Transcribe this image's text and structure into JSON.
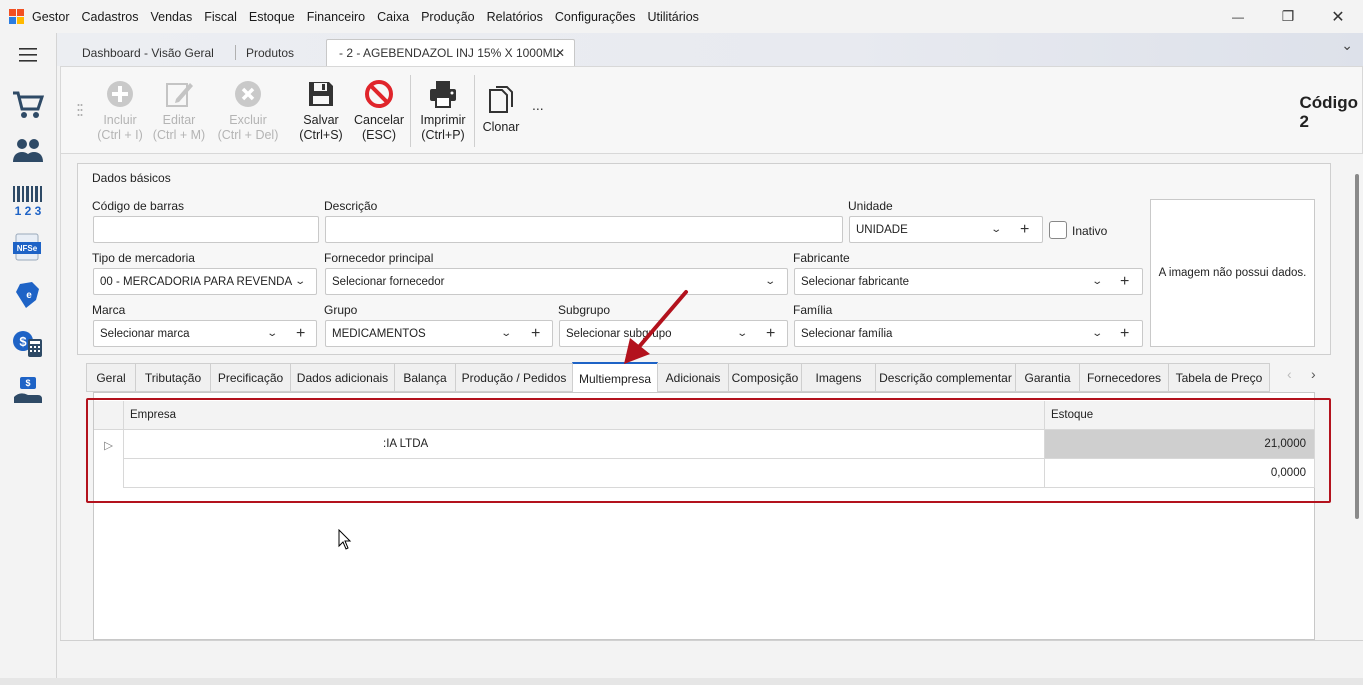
{
  "menu": {
    "items": [
      "Gestor",
      "Cadastros",
      "Vendas",
      "Fiscal",
      "Estoque",
      "Financeiro",
      "Caixa",
      "Produção",
      "Relatórios",
      "Configurações",
      "Utilitários"
    ]
  },
  "window_controls": {
    "minimize": "—",
    "restore": "❐",
    "close": "✕"
  },
  "sidebar": {
    "menu_icon": "hamburger-icon"
  },
  "doc_tabs": {
    "dashboard": "Dashboard - Visão Geral",
    "produtos": "Produtos",
    "active": "- 2 - AGEBENDAZOL  INJ  15% X 1000ML",
    "close": "✕",
    "overflow": "⌄"
  },
  "toolbar": {
    "incluir": {
      "label1": "Incluir",
      "label2": "(Ctrl + I)"
    },
    "editar": {
      "label1": "Editar",
      "label2": "(Ctrl + M)"
    },
    "excluir": {
      "label1": "Excluir",
      "label2": "(Ctrl + Del)"
    },
    "salvar": {
      "label1": "Salvar",
      "label2": "(Ctrl+S)"
    },
    "cancelar": {
      "label1": "Cancelar",
      "label2": "(ESC)"
    },
    "imprimir": {
      "label1": "Imprimir",
      "label2": "(Ctrl+P)"
    },
    "clonar": {
      "label1": "Clonar"
    },
    "more": "...",
    "code_label": "Código",
    "code_value": "2"
  },
  "dados_basicos": {
    "title": "Dados básicos",
    "codigo_barras": {
      "label": "Código de barras",
      "value": ""
    },
    "descricao": {
      "label": "Descrição",
      "value": ""
    },
    "unidade": {
      "label": "Unidade",
      "value": "UNIDADE"
    },
    "inativo": {
      "label": "Inativo"
    },
    "tipo_mercadoria": {
      "label": "Tipo de mercadoria",
      "value": "00 - MERCADORIA PARA REVENDA"
    },
    "fornecedor": {
      "label": "Fornecedor principal",
      "value": "Selecionar fornecedor"
    },
    "fabricante": {
      "label": "Fabricante",
      "value": "Selecionar fabricante"
    },
    "marca": {
      "label": "Marca",
      "value": "Selecionar marca"
    },
    "grupo": {
      "label": "Grupo",
      "value": "MEDICAMENTOS"
    },
    "subgrupo": {
      "label": "Subgrupo",
      "value": "Selecionar subgrupo"
    },
    "familia": {
      "label": "Família",
      "value": "Selecionar família"
    },
    "image_text": "A imagem não possui dados."
  },
  "detail_tabs": [
    "Geral",
    "Tributação",
    "Precificação",
    "Dados adicionais",
    "Balança",
    "Produção / Pedidos",
    "Multiempresa",
    "Adicionais",
    "Composição",
    "Imagens",
    "Descrição complementar",
    "Garantia",
    "Fornecedores",
    "Tabela de Preço"
  ],
  "detail_nav": {
    "prev": "‹",
    "next": "›"
  },
  "grid": {
    "headers": {
      "empresa": "Empresa",
      "estoque": "Estoque"
    },
    "rows": [
      {
        "empresa": ":IA LTDA",
        "estoque": "21,0000"
      },
      {
        "empresa": "",
        "estoque": "0,0000"
      }
    ]
  },
  "colors": {
    "annotation": "#b3121d",
    "active_tab": "#1e63c6"
  }
}
